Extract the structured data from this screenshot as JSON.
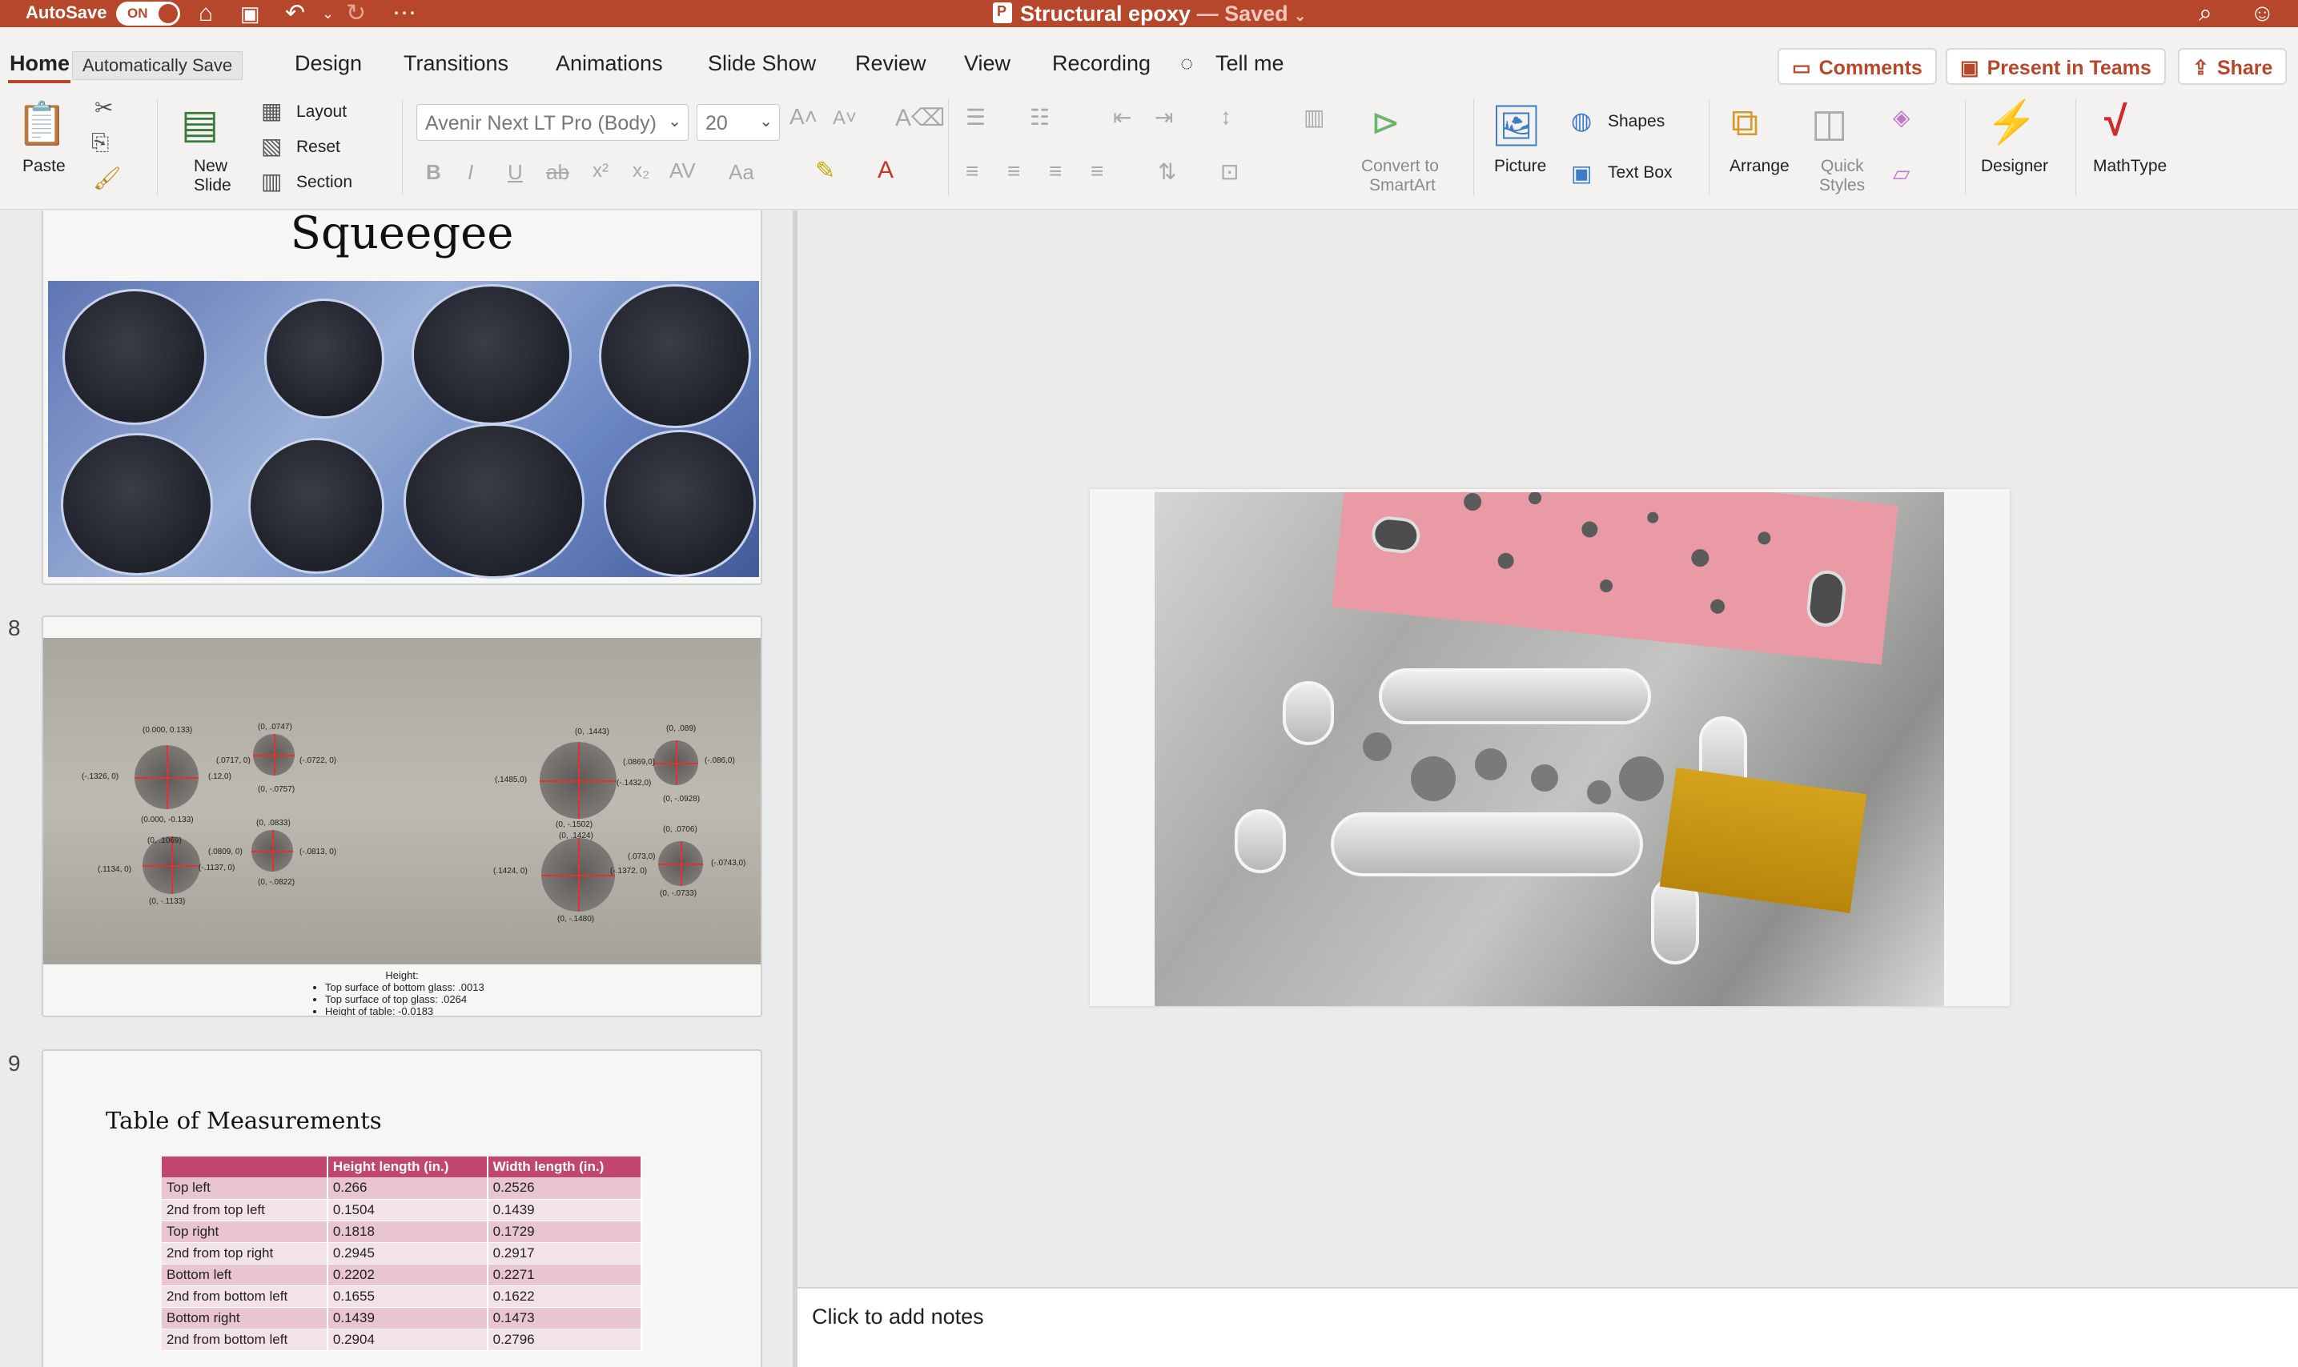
{
  "titlebar": {
    "autosave_label": "AutoSave",
    "autosave_state": "ON",
    "doc_title": "Structural epoxy",
    "doc_status": "— Saved",
    "icons": [
      "home-icon",
      "save-icon",
      "undo-icon",
      "redo-icon",
      "more-icon",
      "search-icon",
      "account-icon"
    ]
  },
  "tabs": {
    "home": "Home",
    "tooltip": "Automatically Save",
    "design": "Design",
    "transitions": "Transitions",
    "animations": "Animations",
    "slideshow": "Slide Show",
    "review": "Review",
    "view": "View",
    "recording": "Recording",
    "tellme": "Tell me",
    "comments": "Comments",
    "present": "Present in Teams",
    "share": "Share"
  },
  "ribbon": {
    "paste": "Paste",
    "new_slide": "New",
    "new_slide_2": "Slide",
    "layout": "Layout",
    "reset": "Reset",
    "section": "Section",
    "font": "Avenir Next LT Pro (Body)",
    "size": "20",
    "convert": "Convert to",
    "convert_2": "SmartArt",
    "picture": "Picture",
    "shapes": "Shapes",
    "textbox": "Text Box",
    "arrange": "Arrange",
    "quick": "Quick",
    "quick_2": "Styles",
    "designer": "Designer",
    "mathtype": "MathType",
    "accent": "#b7472a"
  },
  "thumbs": {
    "s7_title": "Squeegee",
    "s8_num": "8",
    "s9_num": "9",
    "s8_height": "Height:",
    "s8_bullets": [
      "Top surface of bottom glass: .0013",
      "Top surface of top glass: .0264",
      "Height of table: -0.0183"
    ],
    "s8_labels": {
      "l1": "(0.000, 0.133)",
      "l2": "(-.1326, 0)",
      "l3": "(.0717, 0)",
      "l4": "(.12,0)",
      "l5": "(0.000, -0.133)",
      "l6": "(0, .0747)",
      "l7": "(-.0722, 0)",
      "l8": "(0, -.0757)",
      "l9": "(0, .0833)",
      "l10": "(.0809, 0)",
      "l11": "(-.0813, 0)",
      "l12": "(0, -.0822)",
      "l13": "(0, .1069)",
      "l14": "(.1134, 0)",
      "l15": "(-.1137, 0)",
      "l16": "(0, -.1133)",
      "l17": "(0, .1443)",
      "l18": "(.1485,0)",
      "l19": "(-.1432,0)",
      "l20": "(0, -.1502)",
      "l21": "(0, .089)",
      "l22": "(.0869,0)",
      "l23": "(-.086,0)",
      "l24": "(0, -.0928)",
      "l25": "(0, .1424)",
      "l26": "(.1424, 0)",
      "l27": "(-.1372, 0)",
      "l28": "(0, -.1480)",
      "l29": "(0, .0706)",
      "l30": "(.073,0)",
      "l31": "(-.0743,0)",
      "l32": "(0, -.0733)"
    },
    "s9_title": "Table of Measurements",
    "s9_headers": [
      "",
      "Height length (in.)",
      "Width length (in.)"
    ],
    "s9_rows": [
      [
        "Top left",
        "0.266",
        "0.2526"
      ],
      [
        "2nd from top left",
        "0.1504",
        "0.1439"
      ],
      [
        "Top right",
        "0.1818",
        "0.1729"
      ],
      [
        "2nd from top right",
        "0.2945",
        "0.2917"
      ],
      [
        "Bottom left",
        "0.2202",
        "0.2271"
      ],
      [
        "2nd from bottom left",
        "0.1655",
        "0.1622"
      ],
      [
        "Bottom right",
        "0.1439",
        "0.1473"
      ],
      [
        "2nd from bottom left",
        "0.2904",
        "0.2796"
      ]
    ]
  },
  "notes": {
    "placeholder": "Click to add notes"
  }
}
